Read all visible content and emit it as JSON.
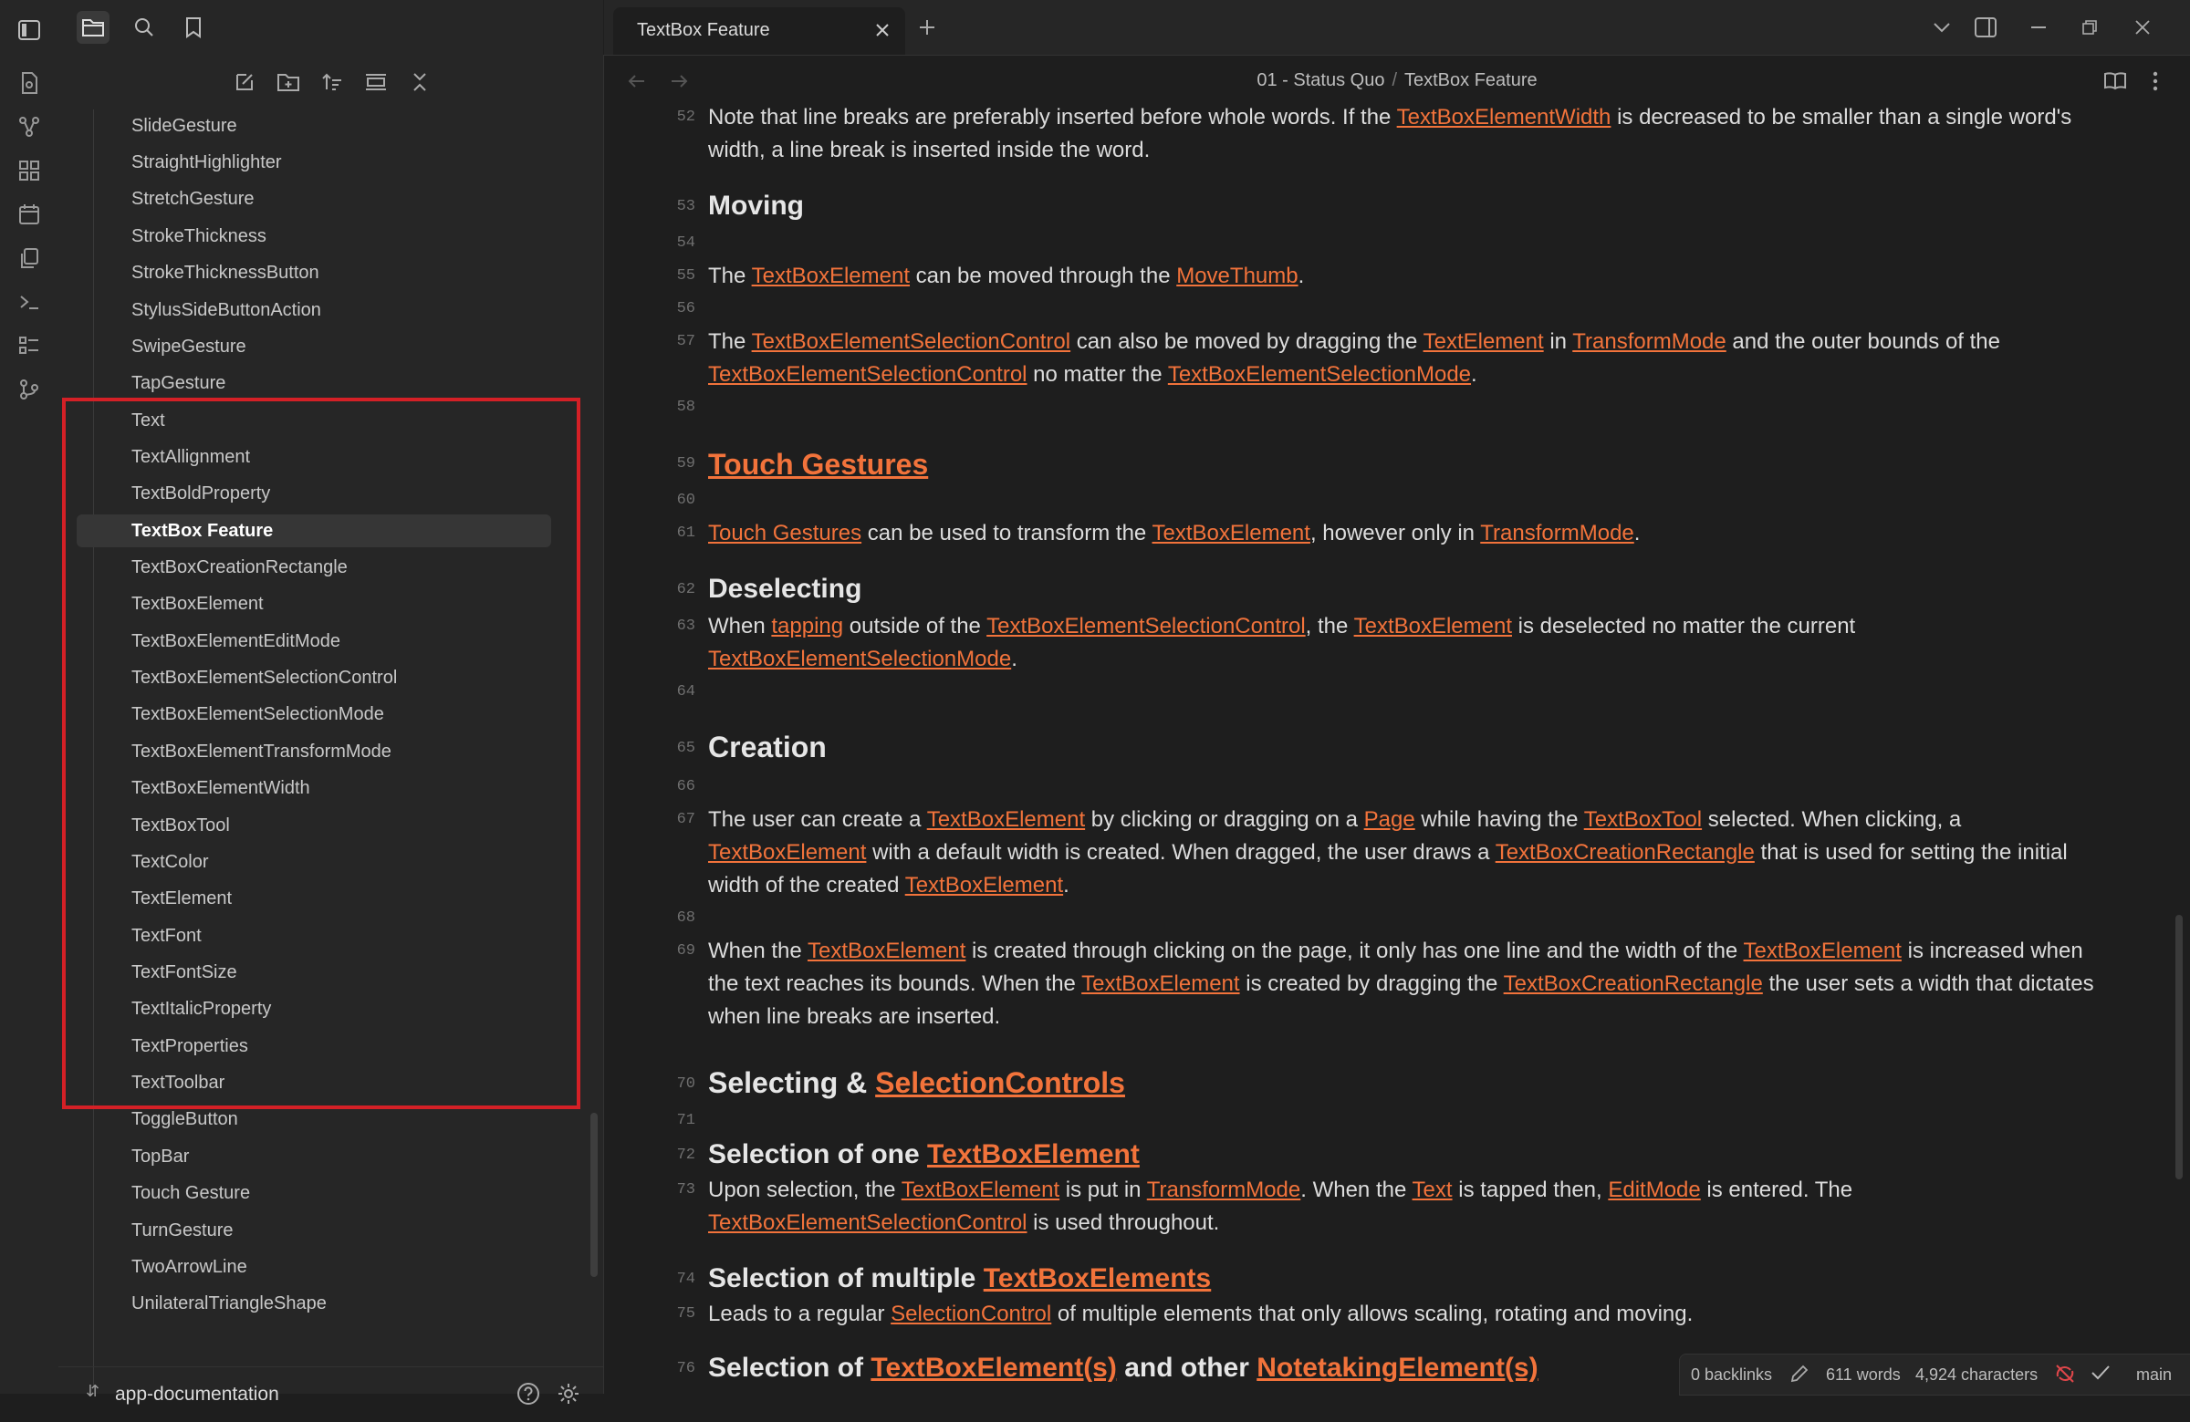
{
  "app": {
    "tab_title": "TextBox Feature",
    "breadcrumb": [
      "01 - Status Quo",
      "TextBox Feature"
    ],
    "breadcrumb_separator": "/",
    "vault_name": "app-documentation",
    "accent_color": "#f2733b",
    "highlight_color": "#d42026"
  },
  "ribbon_icons": [
    "daily-note-icon",
    "graph-icon",
    "canvas-icon",
    "calendar-icon",
    "copy-icon",
    "terminal-icon",
    "templates-icon",
    "git-icon"
  ],
  "file_tree": {
    "items": [
      "SlideGesture",
      "StraightHighlighter",
      "StretchGesture",
      "StrokeThickness",
      "StrokeThicknessButton",
      "StylusSideButtonAction",
      "SwipeGesture",
      "TapGesture",
      "Text",
      "TextAllignment",
      "TextBoldProperty",
      "TextBox Feature",
      "TextBoxCreationRectangle",
      "TextBoxElement",
      "TextBoxElementEditMode",
      "TextBoxElementSelectionControl",
      "TextBoxElementSelectionMode",
      "TextBoxElementTransformMode",
      "TextBoxElementWidth",
      "TextBoxTool",
      "TextColor",
      "TextElement",
      "TextFont",
      "TextFontSize",
      "TextItalicProperty",
      "TextProperties",
      "TextToolbar",
      "ToggleButton",
      "TopBar",
      "Touch Gesture",
      "TurnGesture",
      "TwoArrowLine",
      "UnilateralTriangleShape"
    ],
    "active_item": "TextBox Feature"
  },
  "editor": {
    "lines": {
      "l52": "52",
      "l53": "53",
      "l54": "54",
      "l55": "55",
      "l56": "56",
      "l57": "57",
      "l58": "58",
      "l59": "59",
      "l60": "60",
      "l61": "61",
      "l62": "62",
      "l63": "63",
      "l64": "64",
      "l65": "65",
      "l66": "66",
      "l67": "67",
      "l68": "68",
      "l69": "69",
      "l70": "70",
      "l71": "71",
      "l72": "72",
      "l73": "73",
      "l74": "74",
      "l75": "75",
      "l76": "76"
    },
    "p52": {
      "a": "Note that line breaks are preferably inserted before whole words. If the ",
      "link1": "TextBoxElementWidth",
      "b": " is decreased to be smaller than a single word's width, a line break is inserted inside the word."
    },
    "h53": "Moving",
    "p55": {
      "a": "The ",
      "link1": "TextBoxElement",
      "b": " can be moved through the ",
      "link2": "MoveThumb",
      "c": "."
    },
    "p57": {
      "a": "The ",
      "link1": "TextBoxElementSelectionControl",
      "b": " can also be moved by dragging the ",
      "link2": "TextElement",
      "c": " in ",
      "link3": "TransformMode",
      "d": " and the outer bounds of the ",
      "link4": "TextBoxElementSelectionControl",
      "e": " no matter the ",
      "link5": "TextBoxElementSelectionMode",
      "f": "."
    },
    "h59": "Touch Gestures",
    "p61": {
      "link1": "Touch Gestures",
      "a": " can be used to transform the ",
      "link2": "TextBoxElement",
      "b": ", however only in ",
      "link3": "TransformMode",
      "c": "."
    },
    "h62": "Deselecting",
    "p63": {
      "a": "When ",
      "link1": "tapping",
      "b": " outside of the ",
      "link2": "TextBoxElementSelectionControl",
      "c": ", the ",
      "link3": "TextBoxElement",
      "d": " is deselected no matter the current ",
      "link4": "TextBoxElementSelectionMode",
      "e": "."
    },
    "h65": "Creation",
    "p67": {
      "a": "The user can create a ",
      "link1": "TextBoxElement",
      "b": " by clicking or dragging on a ",
      "link2": "Page",
      "c": " while having the ",
      "link3": "TextBoxTool",
      "d": " selected. When clicking, a ",
      "link4": "TextBoxElement",
      "e": " with a default width is created. When dragged, the user draws a ",
      "link5": "TextBoxCreationRectangle",
      "f": " that is used for setting the initial width of the created ",
      "link6": "TextBoxElement",
      "g": "."
    },
    "p69": {
      "a": "When the ",
      "link1": "TextBoxElement",
      "b": " is created through clicking on the page, it only has one line and the width of the ",
      "link2": "TextBoxElement",
      "c": " is increased when the text reaches its bounds. When the ",
      "link3": "TextBoxElement",
      "d": " is created by dragging the ",
      "link4": "TextBoxCreationRectangle",
      "e": " the user sets a width that dictates when line breaks are inserted."
    },
    "h70": {
      "a": "Selecting & ",
      "link1": "SelectionControls"
    },
    "h72": {
      "a": "Selection of one ",
      "link1": "TextBoxElement"
    },
    "p73": {
      "a": "Upon selection, the ",
      "link1": "TextBoxElement",
      "b": " is put in ",
      "link2": "TransformMode",
      "c": ". When the ",
      "link3": "Text",
      "d": " is tapped then, ",
      "link4": "EditMode",
      "e": " is entered. The ",
      "link5": "TextBoxElementSelectionControl",
      "f": " is used throughout."
    },
    "h74": {
      "a": "Selection of multiple ",
      "link1": "TextBoxElements"
    },
    "p75": {
      "a": "Leads to a regular ",
      "link1": "SelectionControl",
      "b": " of multiple elements that only allows scaling, rotating and moving."
    },
    "h76": {
      "a": "Selection of ",
      "link1": "TextBoxElement(s)",
      "b": " and other ",
      "link2": "NotetakingElement(s)"
    }
  },
  "status_bar": {
    "backlinks": "0 backlinks",
    "words": "611 words",
    "characters": "4,924 characters",
    "branch": "main"
  }
}
